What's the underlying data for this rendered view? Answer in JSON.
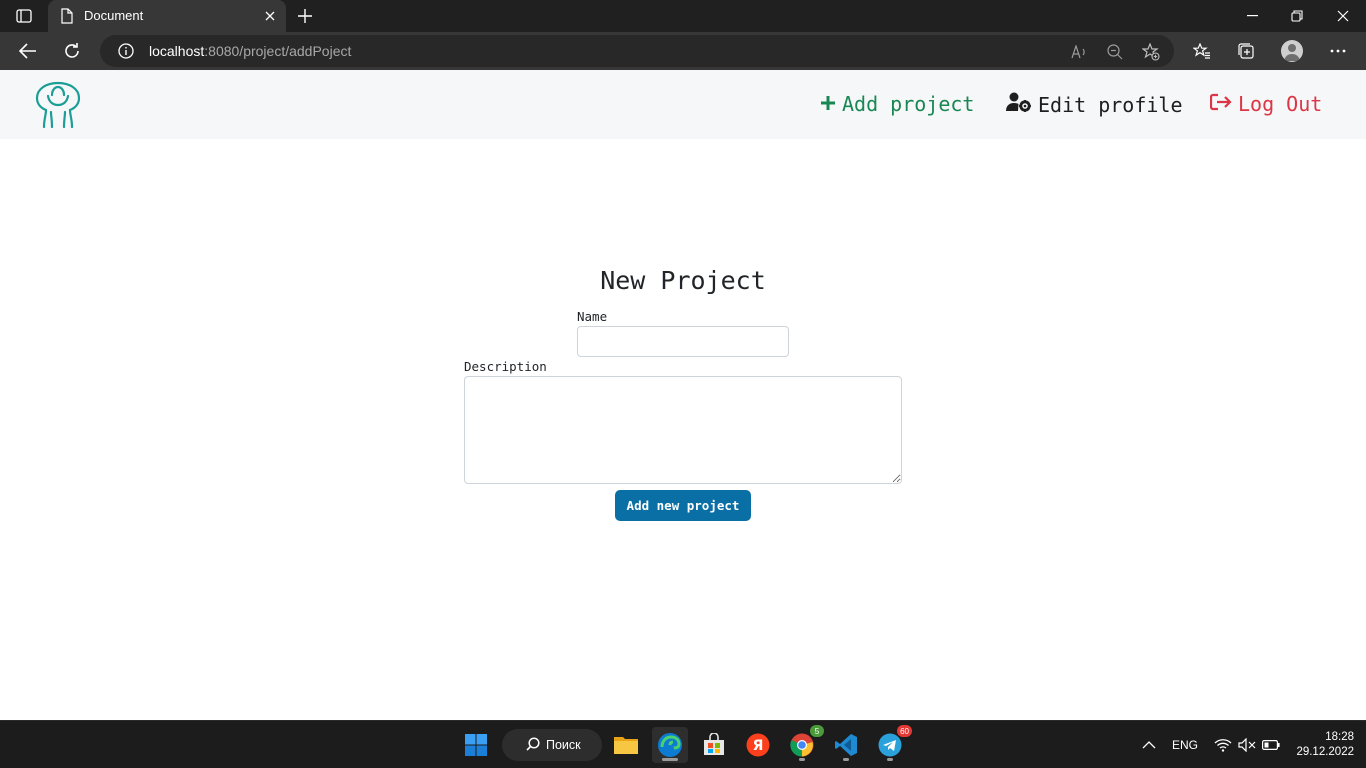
{
  "browser": {
    "tab_title": "Document",
    "url_host": "localhost",
    "url_path": ":8080/project/addPoject"
  },
  "header": {
    "add_project": "Add project",
    "edit_profile": "Edit profile",
    "log_out": "Log Out"
  },
  "form": {
    "title": "New Project",
    "name_label": "Name",
    "name_value": "",
    "description_label": "Description",
    "description_value": "",
    "submit_label": "Add new project"
  },
  "taskbar": {
    "search_label": "Поиск",
    "chrome_badge": "5",
    "telegram_badge": "60",
    "language": "ENG",
    "time": "18:28",
    "date": "29.12.2022"
  },
  "colors": {
    "accent_teal": "#1a9e96",
    "add_green": "#198754",
    "logout_red": "#dc3545",
    "button_blue": "#0a6fa5",
    "header_bg": "#f6f7f8"
  },
  "icons": {
    "logo": "hands-up-person-logo",
    "add": "plus-icon",
    "edit": "user-gear-icon",
    "logout": "sign-out-icon"
  }
}
